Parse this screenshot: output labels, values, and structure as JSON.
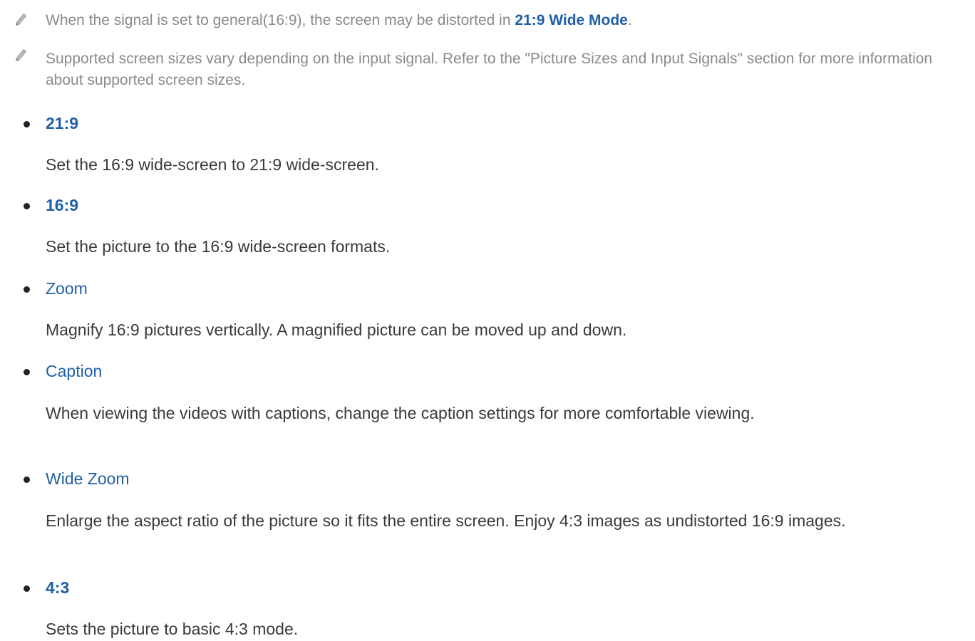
{
  "notes": [
    {
      "icon": "pencil-note-icon",
      "text_before": "When the signal is set to general(16:9), the screen may be distorted in ",
      "highlight": "21:9 Wide Mode",
      "text_after": "."
    },
    {
      "icon": "pencil-note-icon",
      "text": "Supported screen sizes vary depending on the input signal. Refer to the \"Picture Sizes and Input Signals\" section for more information about supported screen sizes."
    }
  ],
  "items": [
    {
      "title": "21:9",
      "description": "Set the 16:9 wide-screen to 21:9 wide-screen."
    },
    {
      "title": "16:9",
      "description": "Set the picture to the 16:9 wide-screen formats."
    },
    {
      "title": "Zoom",
      "description": "Magnify 16:9 pictures vertically. A magnified picture can be moved up and down."
    },
    {
      "title": "Caption",
      "description": "When viewing the videos with captions, change the caption settings for more comfortable viewing."
    },
    {
      "title": "Wide Zoom",
      "description": "Enlarge the aspect ratio of the picture so it fits the entire screen. Enjoy 4:3 images as undistorted 16:9 images."
    },
    {
      "title": "4:3",
      "description": "Sets the picture to basic 4:3 mode."
    }
  ],
  "colors": {
    "accent": "#1f5fa8",
    "note_text": "#8a8a8a",
    "body_text": "#3a3a3a"
  }
}
